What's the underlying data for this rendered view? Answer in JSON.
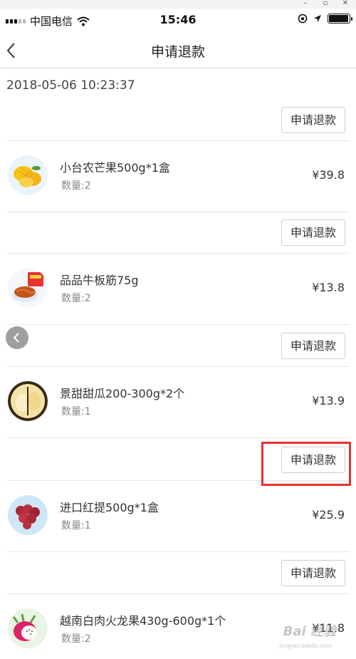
{
  "status_bar": {
    "carrier": "中国电信",
    "time": "15:46",
    "battery_level": 0.95
  },
  "nav": {
    "title": "申请退款",
    "back_icon": "chevron-left-icon"
  },
  "order": {
    "timestamp": "2018-05-06 10:23:37",
    "refund_label": "申请退款"
  },
  "items": [
    {
      "name": "小台农芒果500g*1盒",
      "quantity": "数量:2",
      "price": "¥39.8",
      "refund_label": "申请退款",
      "thumb_icon": "mango-thumbnail"
    },
    {
      "name": "品品牛板筋75g",
      "quantity": "数量:2",
      "price": "¥13.8",
      "refund_label": "申请退款",
      "thumb_icon": "beef-snack-thumbnail"
    },
    {
      "name": "景甜甜瓜200-300g*2个",
      "quantity": "数量:1",
      "price": "¥13.9",
      "refund_label": "申请退款",
      "thumb_icon": "melon-thumbnail"
    },
    {
      "name": "进口红提500g*1盒",
      "quantity": "数量:1",
      "price": "¥25.9",
      "refund_label": "申请退款",
      "thumb_icon": "red-grape-thumbnail"
    },
    {
      "name": "越南白肉火龙果430g-600g*1个",
      "quantity": "数量:2",
      "price": "¥11.8",
      "thumb_icon": "dragon-fruit-thumbnail"
    }
  ],
  "colors": {
    "highlight": "#e8322f",
    "border": "#e6e6e6"
  },
  "watermark": {
    "text": "Bai 经验",
    "sub": "jingyan.baidu.com"
  }
}
